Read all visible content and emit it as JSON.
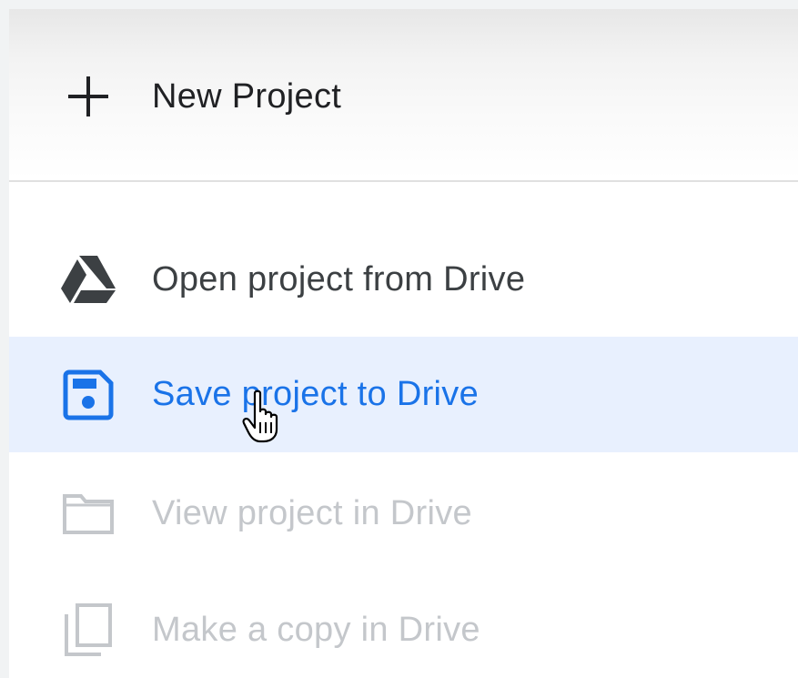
{
  "menu": {
    "items": [
      {
        "id": "new",
        "label": "New Project",
        "icon": "plus-icon",
        "enabled": true
      },
      {
        "id": "open",
        "label": "Open project from Drive",
        "icon": "google-drive-icon",
        "enabled": true
      },
      {
        "id": "save",
        "label": "Save project to Drive",
        "icon": "save-icon",
        "enabled": true,
        "highlighted": true
      },
      {
        "id": "view",
        "label": "View project in Drive",
        "icon": "folder-icon",
        "enabled": false
      },
      {
        "id": "copy",
        "label": "Make a copy in Drive",
        "icon": "copy-icon",
        "enabled": false
      }
    ]
  },
  "colors": {
    "accent": "#1a73e8",
    "highlight_bg": "#e8f0fe",
    "text_primary": "#202124",
    "text_disabled": "#c4c7cb"
  },
  "cursor": {
    "type": "hand-pointer"
  }
}
